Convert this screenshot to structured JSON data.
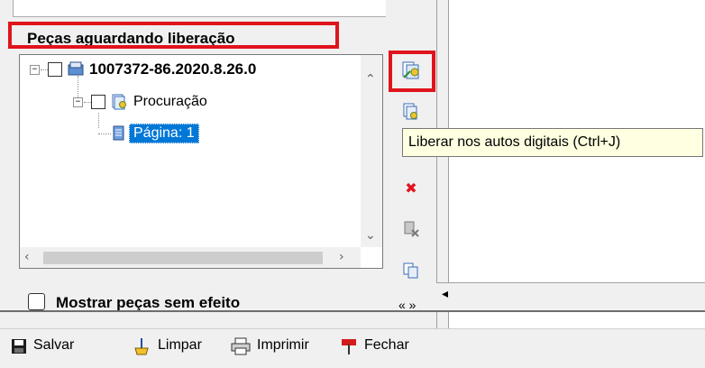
{
  "panel": {
    "section_title": "Peças aguardando liberação",
    "tree": {
      "root": {
        "expander": "−",
        "label": "1007372-86.2020.8.26.0"
      },
      "child": {
        "expander": "−",
        "label": "Procuração"
      },
      "leaf": {
        "label": "Página: 1"
      }
    },
    "show_checkbox_label": "Mostrar peças sem efeito"
  },
  "side_tools": {
    "release_icon": "release-icon",
    "tooltip": "Liberar nos autos digitais (Ctrl+J)",
    "overflow": "« »"
  },
  "toolbar": {
    "save": "Salvar",
    "clear": "Limpar",
    "print": "Imprimir",
    "close": "Fechar"
  },
  "colors": {
    "highlight": "#e0141c",
    "selection": "#0078d7",
    "tooltip_bg": "#ffffe1"
  }
}
